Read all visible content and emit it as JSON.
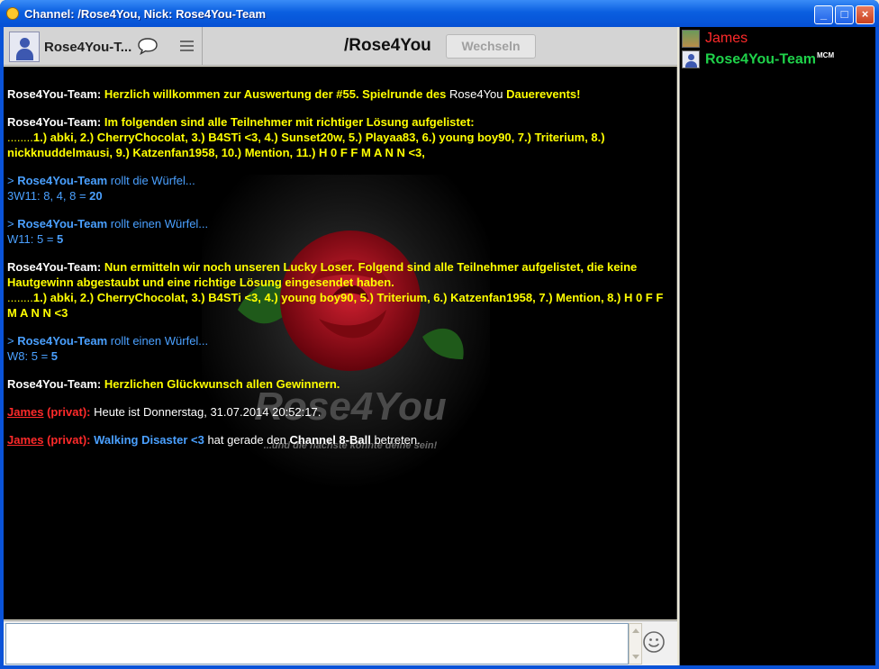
{
  "window": {
    "title": "Channel: /Rose4You,  Nick: Rose4You-Team",
    "controls": {
      "minimize": "_",
      "maximize": "□",
      "close": "×"
    }
  },
  "header": {
    "nick": "Rose4You-T...",
    "channel": "/Rose4You",
    "switch_label": "Wechseln"
  },
  "background": {
    "logo_text": "Rose4You",
    "slogan": "...und die nächste könnte deine sein!"
  },
  "messages": [
    {
      "parts": [
        {
          "t": "Rose4You-Team: ",
          "s": "w"
        },
        {
          "t": "Herzlich willkommen zur Auswertung der #55. Spielrunde des ",
          "s": "y"
        },
        {
          "t": "Rose4You",
          "s": "wn"
        },
        {
          "t": " Dauerevents!",
          "s": "y"
        }
      ]
    },
    {
      "parts": [
        {
          "t": "Rose4You-Team: ",
          "s": "w"
        },
        {
          "t": "Im folgenden sind alle Teilnehmer mit richtiger Lösung aufgelistet:",
          "s": "y"
        },
        {
          "br": true
        },
        {
          "t": "........",
          "s": "yn"
        },
        {
          "t": "1.) abki, 2.) CherryChocolat, 3.) B4STi <3, 4.) Sunset20w, 5.) Playaa83, 6.) young boy90, 7.) Triterium, 8.) nickknuddelmausi, 9.) Katzenfan1958, 10.) Mention, 11.) H 0 F F M A N N <3,",
          "s": "y"
        }
      ]
    },
    {
      "parts": [
        {
          "t": "> ",
          "s": "b"
        },
        {
          "t": "Rose4You-Team",
          "s": "bb"
        },
        {
          "t": " rollt die Würfel...",
          "s": "b"
        },
        {
          "br": true
        },
        {
          "t": "3W11: 8, 4, 8 = ",
          "s": "b"
        },
        {
          "t": "20",
          "s": "bb"
        }
      ]
    },
    {
      "parts": [
        {
          "t": "> ",
          "s": "b"
        },
        {
          "t": "Rose4You-Team",
          "s": "bb"
        },
        {
          "t": " rollt einen Würfel...",
          "s": "b"
        },
        {
          "br": true
        },
        {
          "t": "W11: 5 = ",
          "s": "b"
        },
        {
          "t": "5",
          "s": "bb"
        }
      ]
    },
    {
      "parts": [
        {
          "t": "Rose4You-Team: ",
          "s": "w"
        },
        {
          "t": "Nun ermitteln wir noch unseren Lucky Loser. Folgend sind alle Teilnehmer aufgelistet, die keine Hautgewinn abgestaubt und eine richtige Lösung eingesendet haben.",
          "s": "y"
        },
        {
          "br": true
        },
        {
          "t": "........",
          "s": "yn"
        },
        {
          "t": "1.) abki, 2.) CherryChocolat, 3.) B4STi <3, 4.) young boy90, 5.) Triterium, 6.) Katzenfan1958, 7.) Mention, 8.) H 0 F F M A N N <3",
          "s": "y"
        }
      ]
    },
    {
      "parts": [
        {
          "t": "> ",
          "s": "b"
        },
        {
          "t": "Rose4You-Team",
          "s": "bb"
        },
        {
          "t": " rollt einen Würfel...",
          "s": "b"
        },
        {
          "br": true
        },
        {
          "t": "W8: 5 = ",
          "s": "b"
        },
        {
          "t": "5",
          "s": "bb"
        }
      ]
    },
    {
      "parts": [
        {
          "t": "Rose4You-Team: ",
          "s": "w"
        },
        {
          "t": "Herzlichen Glückwunsch allen Gewinnern.",
          "s": "y"
        }
      ]
    },
    {
      "parts": [
        {
          "t": "James",
          "s": "ru"
        },
        {
          "t": " (privat): ",
          "s": "r"
        },
        {
          "t": "Heute ist Donnerstag, 31.07.2014 20:52:17.",
          "s": "wn"
        }
      ]
    },
    {
      "parts": [
        {
          "t": "James",
          "s": "ru"
        },
        {
          "t": " (privat): ",
          "s": "r"
        },
        {
          "t": "Walking Disaster <3",
          "s": "bb"
        },
        {
          "t": " hat gerade den ",
          "s": "wn"
        },
        {
          "t": "Channel 8-Ball",
          "s": "w"
        },
        {
          "t": " betreten.",
          "s": "wn"
        }
      ]
    }
  ],
  "input": {
    "value": ""
  },
  "userlist": [
    {
      "name": "James",
      "badge": ""
    },
    {
      "name": "Rose4You-Team",
      "badge": "MCM"
    }
  ],
  "colors": {
    "nick_white": "#ffffff",
    "message_yellow": "#ffff00",
    "dice_blue": "#4aa0ff",
    "private_red": "#ff2a2a",
    "online_green": "#1fd24a",
    "rose_red": "#b0101a"
  }
}
